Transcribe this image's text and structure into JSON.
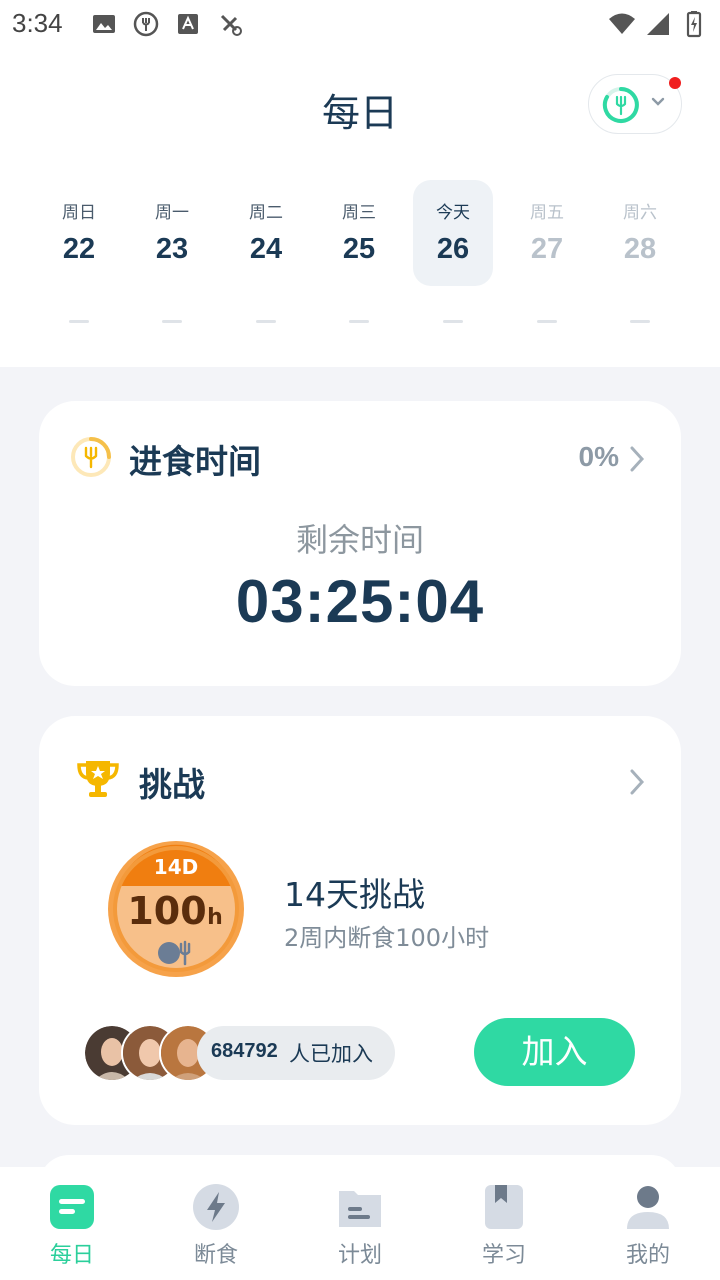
{
  "status_bar": {
    "time": "3:34"
  },
  "header": {
    "title": "每日"
  },
  "week": [
    {
      "name": "周日",
      "num": "22",
      "state": "past"
    },
    {
      "name": "周一",
      "num": "23",
      "state": "past"
    },
    {
      "name": "周二",
      "num": "24",
      "state": "past"
    },
    {
      "name": "周三",
      "num": "25",
      "state": "past"
    },
    {
      "name": "今天",
      "num": "26",
      "state": "today"
    },
    {
      "name": "周五",
      "num": "27",
      "state": "future"
    },
    {
      "name": "周六",
      "num": "28",
      "state": "future"
    }
  ],
  "eating_card": {
    "title": "进食时间",
    "percent": "0%",
    "remaining_label": "剩余时间",
    "remaining_time": "03:25:04"
  },
  "challenge_card": {
    "title": "挑战",
    "badge_top": "14D",
    "badge_main": "100",
    "badge_unit": "h",
    "name": "14天挑战",
    "description": "2周内断食100小时",
    "joined_count": "684792",
    "joined_text": "人已加入",
    "join_button": "加入"
  },
  "bottom_nav": [
    {
      "label": "每日",
      "icon": "daily-icon",
      "active": true
    },
    {
      "label": "断食",
      "icon": "bolt-icon",
      "active": false
    },
    {
      "label": "计划",
      "icon": "plan-folder-icon",
      "active": false
    },
    {
      "label": "学习",
      "icon": "bookmark-book-icon",
      "active": false
    },
    {
      "label": "我的",
      "icon": "profile-icon",
      "active": false
    }
  ],
  "colors": {
    "accent": "#2fd9a3",
    "text_dark": "#1b3a55",
    "background": "#f3f4f8",
    "trophy": "#f5b700",
    "badge_orange": "#f39a3b"
  }
}
